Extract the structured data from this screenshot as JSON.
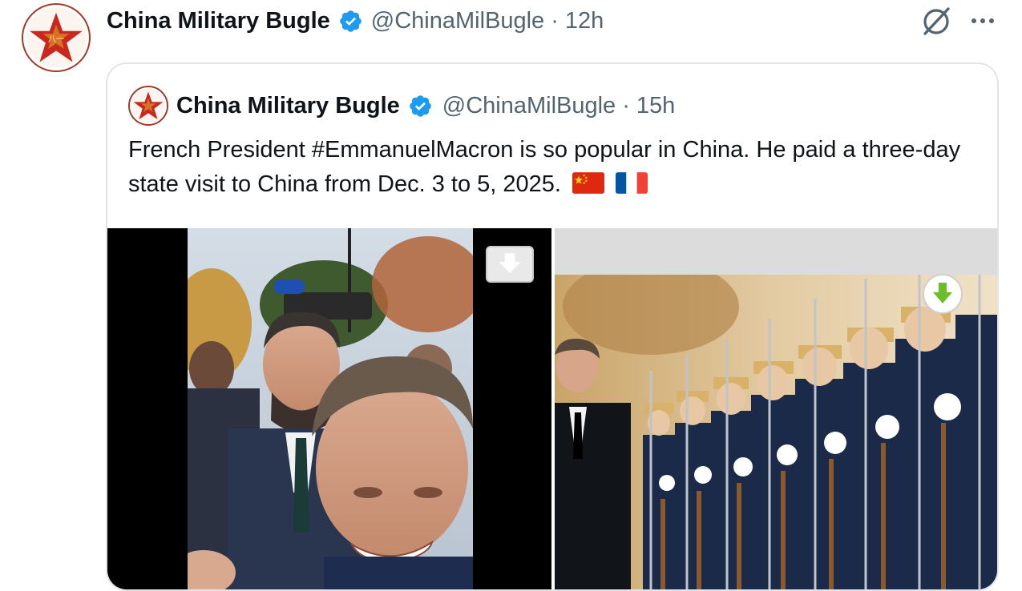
{
  "tweet": {
    "author_name": "China Military Bugle",
    "handle": "@ChinaMilBugle",
    "separator": "·",
    "time": "12h",
    "avatar_icon": "red-star-emblem-icon",
    "verified_icon": "verified-badge-icon",
    "grok_icon": "grok-icon",
    "more_icon": "more-options-icon"
  },
  "quoted": {
    "author_name": "China Military Bugle",
    "handle": "@ChinaMilBugle",
    "separator": "·",
    "time": "15h",
    "text": "French President #EmmanuelMacron is so popular in China. He paid a three-day state visit to China from Dec. 3 to 5, 2025.",
    "flags": [
      "china-flag-icon",
      "france-flag-icon"
    ],
    "media": [
      {
        "kind": "video",
        "icon": "download-icon"
      },
      {
        "kind": "photo",
        "icon": "download-icon"
      }
    ]
  },
  "colors": {
    "verified_blue": "#1d9bf0",
    "secondary_text": "#536471",
    "border": "#e1e5e8",
    "emblem_red": "#c8281e",
    "download_green": "#6cbf2a"
  }
}
